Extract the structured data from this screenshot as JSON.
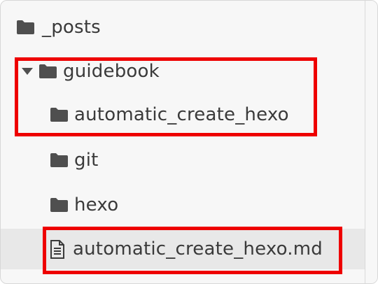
{
  "tree": {
    "items": [
      {
        "label": "_posts",
        "icon": "folder-icon",
        "expanded": null,
        "selected": false
      },
      {
        "label": "guidebook",
        "icon": "folder-icon",
        "expanded": true,
        "selected": false
      },
      {
        "label": "automatic_create_hexo",
        "icon": "folder-icon",
        "expanded": null,
        "selected": false
      },
      {
        "label": "git",
        "icon": "folder-icon",
        "expanded": null,
        "selected": false
      },
      {
        "label": "hexo",
        "icon": "folder-icon",
        "expanded": null,
        "selected": false
      },
      {
        "label": "automatic_create_hexo.md",
        "icon": "file-icon",
        "expanded": null,
        "selected": true
      }
    ]
  },
  "colors": {
    "highlight": "#ee0000",
    "selected_row": "#e8e8e8",
    "icon": "#4f4f4f",
    "text": "#3a3a3a"
  }
}
